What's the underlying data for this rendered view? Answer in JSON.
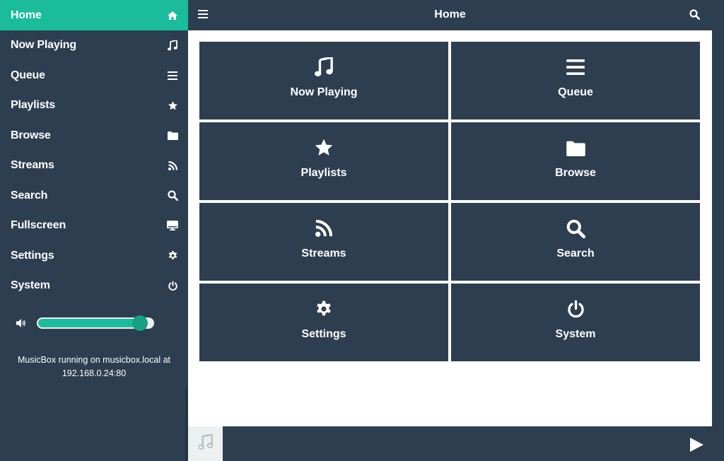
{
  "sidebar": {
    "items": [
      {
        "label": "Home",
        "icon": "home-icon"
      },
      {
        "label": "Now Playing",
        "icon": "music-note-icon"
      },
      {
        "label": "Queue",
        "icon": "list-icon"
      },
      {
        "label": "Playlists",
        "icon": "star-icon"
      },
      {
        "label": "Browse",
        "icon": "folder-icon"
      },
      {
        "label": "Streams",
        "icon": "rss-icon"
      },
      {
        "label": "Search",
        "icon": "search-icon"
      },
      {
        "label": "Fullscreen",
        "icon": "desktop-icon"
      },
      {
        "label": "Settings",
        "icon": "gear-icon"
      },
      {
        "label": "System",
        "icon": "power-icon"
      }
    ],
    "volume": {
      "level": 0.88
    },
    "info_line1": "MusicBox running on musicbox.local at",
    "info_line2": "192.168.0.24:80"
  },
  "header": {
    "title": "Home"
  },
  "tiles": [
    {
      "label": "Now Playing",
      "icon": "music-note-icon"
    },
    {
      "label": "Queue",
      "icon": "list-icon"
    },
    {
      "label": "Playlists",
      "icon": "star-icon"
    },
    {
      "label": "Browse",
      "icon": "folder-icon"
    },
    {
      "label": "Streams",
      "icon": "rss-icon"
    },
    {
      "label": "Search",
      "icon": "search-icon"
    },
    {
      "label": "Settings",
      "icon": "gear-icon"
    },
    {
      "label": "System",
      "icon": "power-icon"
    }
  ],
  "colors": {
    "accent": "#1abc9c",
    "dark": "#2d3e50",
    "background": "#ffffff"
  }
}
